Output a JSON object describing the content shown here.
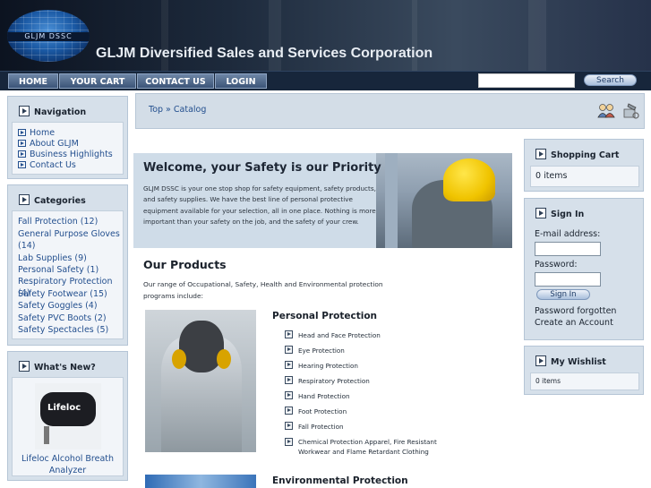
{
  "site": {
    "logo_text": "GLJM DSSC",
    "title": "GLJM Diversified Sales and Services Corporation"
  },
  "nav": {
    "items": [
      {
        "label": "HOME"
      },
      {
        "label": "YOUR CART"
      },
      {
        "label": "CONTACT US"
      },
      {
        "label": "LOGIN"
      }
    ],
    "search_button": "Search",
    "search_value": ""
  },
  "breadcrumb": "Top » Catalog",
  "navigation_box": {
    "title": "Navigation",
    "items": [
      "Home",
      "About GLJM",
      "Business Highlights",
      "Contact Us"
    ]
  },
  "categories_box": {
    "title": "Categories",
    "items": [
      "Fall Protection (12)",
      "General Purpose Gloves (14)",
      "Lab Supplies (9)",
      "Personal Safety (1)",
      "Respiratory Protection (4)",
      "Safety Footwear (15)",
      "Safety Goggles (4)",
      "Safety PVC Boots (2)",
      "Safety Spectacles (5)"
    ]
  },
  "whats_new": {
    "title": "What's New?",
    "product_name": "Lifeloc Alcohol Breath Analyzer",
    "image_text": "Lifeloc"
  },
  "welcome": {
    "title": "Welcome, your Safety is our Priority",
    "text": "GLJM DSSC is your one stop shop for safety equipment, safety products, and safety supplies. We have the best line of personal protective equipment available for your selection, all in one place. Nothing is more important than your safety on the job, and the safety of your crew."
  },
  "products": {
    "title": "Our Products",
    "intro": "Our range of Occupational, Safety, Health and Environmental protection programs include:",
    "personal_protection": {
      "title": "Personal Protection",
      "items": [
        "Head and Face Protection",
        "Eye Protection",
        "Hearing Protection",
        "Respiratory Protection",
        "Hand Protection",
        "Foot Protection",
        "Fall Protection",
        "Chemical Protection Apparel, Fire Resistant Workwear and Flame Retardant Clothing"
      ]
    },
    "environmental_protection": {
      "title": "Environmental Protection"
    }
  },
  "cart_box": {
    "title": "Shopping Cart",
    "status": "0 items"
  },
  "signin_box": {
    "title": "Sign In",
    "email_label": "E-mail address:",
    "password_label": "Password:",
    "button": "Sign In",
    "forgot": "Password forgotten",
    "create": "Create an Account"
  },
  "wishlist_box": {
    "title": "My Wishlist",
    "status": "0 items"
  },
  "icons": [
    "users-icon",
    "recycle-tools-icon",
    "arrow-bullet-icon",
    "arrow-square-icon"
  ],
  "colors": {
    "header_dark": "#17263b",
    "box_bg": "#d6e0ea",
    "link": "#234f8e"
  }
}
